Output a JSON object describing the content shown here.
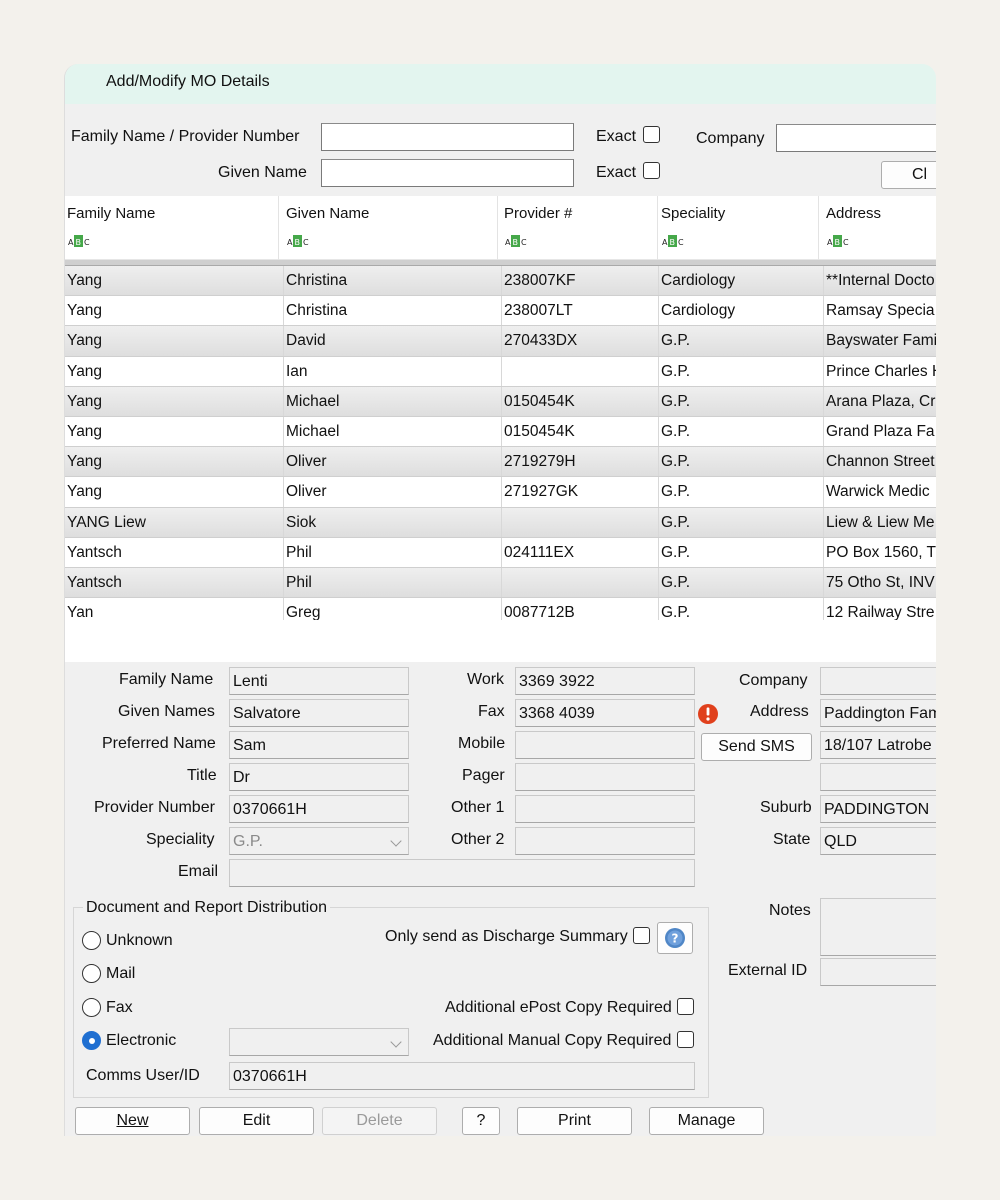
{
  "window": {
    "title": "Add/Modify MO Details"
  },
  "search": {
    "family_label": "Family Name / Provider Number",
    "given_label": "Given Name",
    "exact_label": "Exact",
    "company_label": "Company",
    "clear_button": "Cl"
  },
  "grid": {
    "columns": [
      "Family Name",
      "Given Name",
      "Provider #",
      "Speciality",
      "Address"
    ],
    "rows": [
      [
        "Yang",
        "Christina",
        "238007KF",
        "Cardiology",
        "**Internal Docto"
      ],
      [
        "Yang",
        "Christina",
        "238007LT",
        "Cardiology",
        "Ramsay Specia"
      ],
      [
        "Yang",
        "David",
        "270433DX",
        "G.P.",
        "Bayswater Fami"
      ],
      [
        "Yang",
        "Ian",
        "",
        "G.P.",
        "Prince Charles H"
      ],
      [
        "Yang",
        "Michael",
        "0150454K",
        "G.P.",
        "Arana Plaza, Cr"
      ],
      [
        "Yang",
        "Michael",
        "0150454K",
        "G.P.",
        "Grand Plaza Fa"
      ],
      [
        "Yang",
        "Oliver",
        "2719279H",
        "G.P.",
        "Channon Street"
      ],
      [
        "Yang",
        "Oliver",
        "271927GK",
        "G.P.",
        "Warwick Medic"
      ],
      [
        "YANG Liew",
        "Siok",
        "",
        "G.P.",
        "Liew & Liew Me"
      ],
      [
        "Yantsch",
        "Phil",
        "024111EX",
        "G.P.",
        "PO Box 1560, T"
      ],
      [
        "Yantsch",
        "Phil",
        "",
        "G.P.",
        "75 Otho St, INV"
      ],
      [
        "Yan",
        "Greg",
        "0087712B",
        "G.P.",
        "12 Railway Stre"
      ]
    ]
  },
  "details": {
    "family_name_label": "Family Name",
    "family_name": "Lenti",
    "given_names_label": "Given Names",
    "given_names": "Salvatore",
    "preferred_name_label": "Preferred Name",
    "preferred_name": "Sam",
    "title_label": "Title",
    "title": "Dr",
    "provider_number_label": "Provider Number",
    "provider_number": "0370661H",
    "speciality_label": "Speciality",
    "speciality": "G.P.",
    "email_label": "Email",
    "email": "",
    "work_label": "Work",
    "work": "3369 3922",
    "fax_label": "Fax",
    "fax": "3368 4039",
    "mobile_label": "Mobile",
    "mobile": "",
    "pager_label": "Pager",
    "pager": "",
    "other1_label": "Other 1",
    "other1": "",
    "other2_label": "Other 2",
    "other2": "",
    "company_label": "Company",
    "company": "",
    "address_label": "Address",
    "address1": "Paddington Fam",
    "address2": "18/107 Latrobe",
    "send_sms": "Send SMS",
    "suburb_label": "Suburb",
    "suburb": "PADDINGTON",
    "state_label": "State",
    "state": "QLD",
    "notes_label": "Notes",
    "external_id_label": "External ID"
  },
  "distribution": {
    "group_label": "Document and Report Distribution",
    "options": [
      "Unknown",
      "Mail",
      "Fax",
      "Electronic"
    ],
    "selected": "Electronic",
    "discharge_label": "Only send as Discharge Summary",
    "epost_label": "Additional ePost Copy Required",
    "manual_label": "Additional Manual Copy Required",
    "comms_label": "Comms User/ID",
    "comms_value": "0370661H"
  },
  "buttons": {
    "new": "New",
    "edit": "Edit",
    "delete": "Delete",
    "help": "?",
    "print": "Print",
    "manage": "Manage"
  },
  "colors": {
    "accent": "#1f6fd1",
    "titlebar": "#e3f5ef",
    "warning": "#e0401c"
  }
}
